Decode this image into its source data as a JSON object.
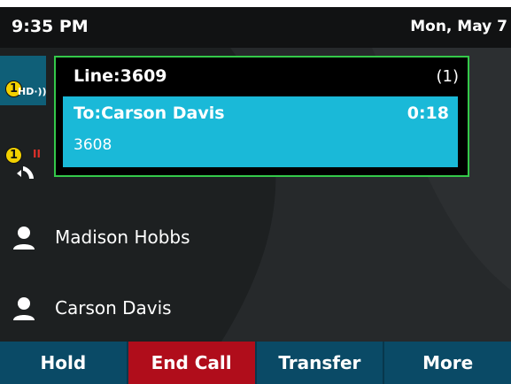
{
  "status": {
    "time": "9:35 PM",
    "date": "Mon, May 7"
  },
  "line_keys": [
    {
      "badge": "1",
      "label": "HD",
      "icon": "hd-voice-icon"
    },
    {
      "badge": "1",
      "icon": "held-call-icon"
    }
  ],
  "call_window": {
    "line": "Line:3609",
    "count": "(1)",
    "active_call": {
      "to": "To:Carson Davis",
      "duration": "0:18",
      "number": "3608"
    }
  },
  "contacts": [
    {
      "name": "Madison Hobbs",
      "icon": "contact-person-icon"
    },
    {
      "name": "Carson Davis",
      "icon": "contact-person-icon"
    }
  ],
  "softkeys": {
    "hold": "Hold",
    "end_call": "End Call",
    "transfer": "Transfer",
    "more": "More"
  },
  "colors": {
    "accent": "#1ab9d8",
    "end_call": "#b00d1b",
    "softkey_bar": "#0a4a66",
    "highlight_border": "#34c94a",
    "badge": "#f2d000"
  }
}
